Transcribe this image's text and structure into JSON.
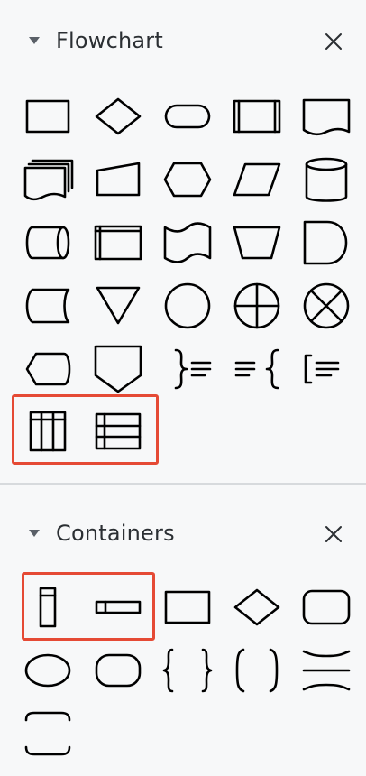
{
  "sections": [
    {
      "title": "Flowchart",
      "expanded": true,
      "shapes": [
        {
          "name": "process-shape"
        },
        {
          "name": "decision-shape"
        },
        {
          "name": "terminator-shape"
        },
        {
          "name": "predefined-process-shape"
        },
        {
          "name": "document-shape"
        },
        {
          "name": "multi-document-shape"
        },
        {
          "name": "manual-input-shape"
        },
        {
          "name": "preparation-shape"
        },
        {
          "name": "data-shape"
        },
        {
          "name": "database-shape"
        },
        {
          "name": "direct-access-storage-shape"
        },
        {
          "name": "internal-storage-shape"
        },
        {
          "name": "punched-tape-shape"
        },
        {
          "name": "manual-operation-shape"
        },
        {
          "name": "delay-shape"
        },
        {
          "name": "stored-data-shape"
        },
        {
          "name": "merge-shape"
        },
        {
          "name": "connector-shape"
        },
        {
          "name": "or-shape"
        },
        {
          "name": "summing-junction-shape"
        },
        {
          "name": "display-shape"
        },
        {
          "name": "off-page-connector-shape"
        },
        {
          "name": "annotation-right-brace-shape"
        },
        {
          "name": "annotation-left-brace-shape"
        },
        {
          "name": "annotation-bracket-shape"
        },
        {
          "name": "vertical-swimlane-pool-shape",
          "highlighted": true
        },
        {
          "name": "horizontal-swimlane-pool-shape",
          "highlighted": true
        }
      ]
    },
    {
      "title": "Containers",
      "expanded": true,
      "shapes": [
        {
          "name": "vertical-container-shape",
          "highlighted": true
        },
        {
          "name": "horizontal-container-shape",
          "highlighted": true
        },
        {
          "name": "rectangle-container-shape"
        },
        {
          "name": "diamond-container-shape"
        },
        {
          "name": "rounded-rectangle-container-shape"
        },
        {
          "name": "ellipse-container-shape"
        },
        {
          "name": "pill-container-shape"
        },
        {
          "name": "braces-container-shape"
        },
        {
          "name": "brackets-container-shape"
        },
        {
          "name": "horizontal-brackets-container-shape"
        },
        {
          "name": "rounded-brackets-container-shape"
        }
      ]
    }
  ],
  "icons": {
    "expand": "caret-down-icon",
    "close": "close-icon"
  },
  "colors": {
    "background": "#f7f8f9",
    "highlight": "#e54a35",
    "text": "#2b2f33",
    "divider": "#d7dadd"
  }
}
